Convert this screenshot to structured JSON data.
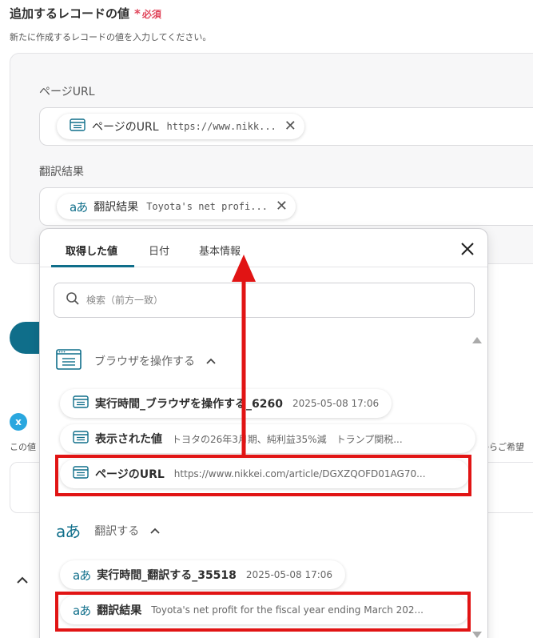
{
  "section": {
    "title": "追加するレコードの値",
    "required_star": "*",
    "required_label": "必須",
    "description": "新たに作成するレコードの値を入力してください。"
  },
  "fields": [
    {
      "label": "ページURL",
      "chip_label": "ページのURL",
      "chip_value": "https://www.nikk...",
      "icon": "browser-doc-icon"
    },
    {
      "label": "翻訳結果",
      "chip_label": "翻訳結果",
      "chip_value": "Toyota's net profi...",
      "icon": "translate-icon"
    }
  ],
  "background": {
    "left_text": "この値",
    "right_text": "からご希望",
    "x_badge": "x"
  },
  "popup": {
    "tabs": [
      {
        "label": "取得した値",
        "active": true
      },
      {
        "label": "日付",
        "active": false
      },
      {
        "label": "基本情報",
        "active": false
      }
    ],
    "search_placeholder": "検索（前方一致）",
    "groups": [
      {
        "title": "ブラウザを操作する",
        "icon": "browser-icon",
        "items": [
          {
            "label": "実行時間_ブラウザを操作する_6260",
            "value": "2025-05-08 17:06"
          },
          {
            "label": "表示された値",
            "value": "トヨタの26年3月期、純利益35%減　トランプ関税..."
          },
          {
            "label": "ページのURL",
            "value": "https://www.nikkei.com/article/DGXZQOFD01AG70...",
            "highlighted": true
          }
        ]
      },
      {
        "title": "翻訳する",
        "icon": "translate-icon",
        "items": [
          {
            "label": "実行時間_翻訳する_35518",
            "value": "2025-05-08 17:06"
          },
          {
            "label": "翻訳結果",
            "value": "Toyota's net profit for the fiscal year ending March 202...",
            "highlighted": true
          }
        ]
      }
    ]
  },
  "colors": {
    "accent": "#0f6e8a",
    "required": "#e0455a",
    "annotation_red": "#e11414"
  }
}
